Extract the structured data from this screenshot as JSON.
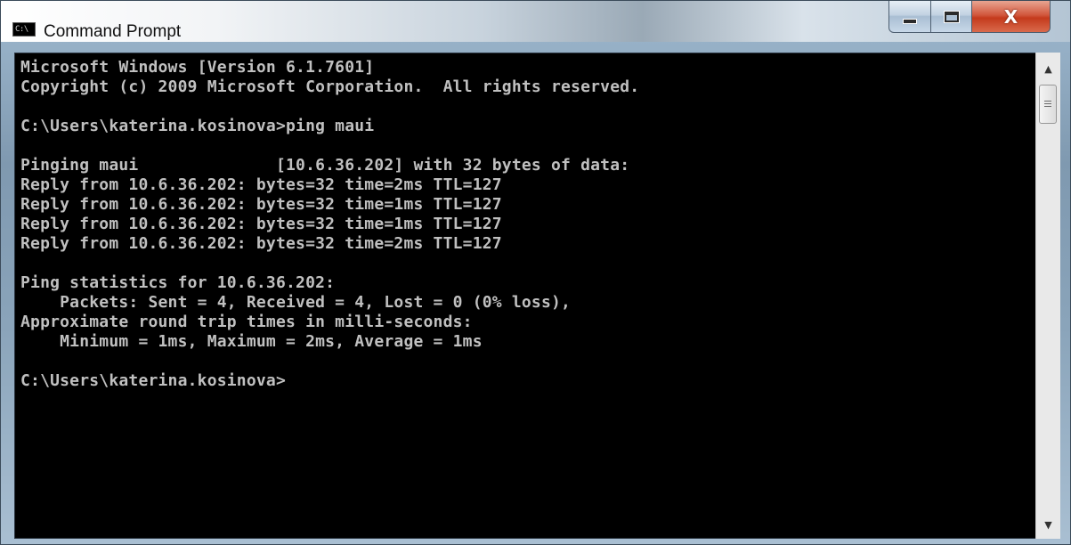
{
  "window": {
    "title": "Command Prompt",
    "icon_label": "C:\\"
  },
  "caption_buttons": {
    "minimize": "minimize-icon",
    "maximize": "maximize-icon",
    "close_glyph": "X"
  },
  "console": {
    "lines": [
      "Microsoft Windows [Version 6.1.7601]",
      "Copyright (c) 2009 Microsoft Corporation.  All rights reserved.",
      "",
      "C:\\Users\\katerina.kosinova>ping maui",
      "",
      "Pinging maui              [10.6.36.202] with 32 bytes of data:",
      "Reply from 10.6.36.202: bytes=32 time=2ms TTL=127",
      "Reply from 10.6.36.202: bytes=32 time=1ms TTL=127",
      "Reply from 10.6.36.202: bytes=32 time=1ms TTL=127",
      "Reply from 10.6.36.202: bytes=32 time=2ms TTL=127",
      "",
      "Ping statistics for 10.6.36.202:",
      "    Packets: Sent = 4, Received = 4, Lost = 0 (0% loss),",
      "Approximate round trip times in milli-seconds:",
      "    Minimum = 1ms, Maximum = 2ms, Average = 1ms",
      "",
      "C:\\Users\\katerina.kosinova>"
    ]
  },
  "scrollbar": {
    "up_arrow": "▲",
    "down_arrow": "▼"
  }
}
